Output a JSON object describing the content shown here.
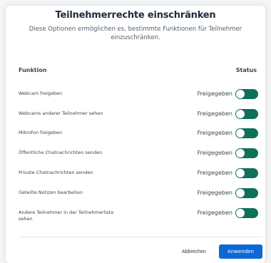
{
  "dialog": {
    "title": "Teilnehmerrechte einschränken",
    "description_line1": "Diese Optionen ermöglichen es, bestimmte Funktionen für Teilnehmer",
    "description_line2": "einzuschränken.",
    "column_function": "Funktion",
    "column_status": "Status"
  },
  "rows": [
    {
      "label": "Webcam freigeben",
      "status": "Freigegeben",
      "enabled": true
    },
    {
      "label": "Webcams anderer Teilnehmer sehen",
      "status": "Freigegeben",
      "enabled": true
    },
    {
      "label": "Mikrofon freigeben",
      "status": "Freigegeben",
      "enabled": true
    },
    {
      "label": "Öffentliche Chatnachrichten senden",
      "status": "Freigegeben",
      "enabled": true
    },
    {
      "label": "Private Chatnachrichten senden",
      "status": "Freigegeben",
      "enabled": true
    },
    {
      "label": "Geteilte Notizen bearbeiten",
      "status": "Freigegeben",
      "enabled": true
    },
    {
      "label_line1": "Andere Teilnehmer in der Teilnehmerliste",
      "label_line2": "sehen",
      "status": "Freigegeben",
      "enabled": true
    }
  ],
  "buttons": {
    "cancel": "Abbrechen",
    "apply": "Anwenden"
  },
  "colors": {
    "toggle_on": "#0f6f5a",
    "primary": "#0d68d6"
  }
}
